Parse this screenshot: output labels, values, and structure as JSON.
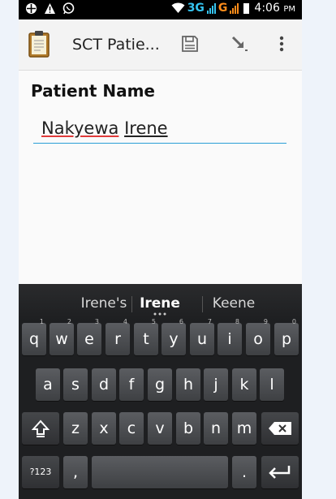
{
  "status_bar": {
    "network_label": "3G",
    "network_label_2": "G",
    "time": "4:06",
    "ampm": "PM"
  },
  "action_bar": {
    "title": "SCT Patie...",
    "icons": [
      "clipboard-icon",
      "save-icon",
      "send-icon",
      "overflow-menu-icon"
    ]
  },
  "form": {
    "label": "Patient Name",
    "value_word1": "Nakyewa",
    "value_word2": "Irene"
  },
  "keyboard": {
    "suggestions": [
      "Irene's",
      "Irene",
      "Keene"
    ],
    "row1": [
      "q",
      "w",
      "e",
      "r",
      "t",
      "y",
      "u",
      "i",
      "o",
      "p"
    ],
    "row1_hints": [
      "1",
      "2",
      "3",
      "4",
      "5",
      "6",
      "7",
      "8",
      "9",
      "0"
    ],
    "row2": [
      "a",
      "s",
      "d",
      "f",
      "g",
      "h",
      "j",
      "k",
      "l"
    ],
    "row3": [
      "z",
      "x",
      "c",
      "v",
      "b",
      "n",
      "m"
    ],
    "symbols_key": "?123",
    "comma_key": ",",
    "period_key": "."
  },
  "colors": {
    "accent": "#2a9fd6",
    "spellcheck": "#e03b3b",
    "network_3g": "#35c4f0",
    "network_g": "#ff8c1a"
  }
}
